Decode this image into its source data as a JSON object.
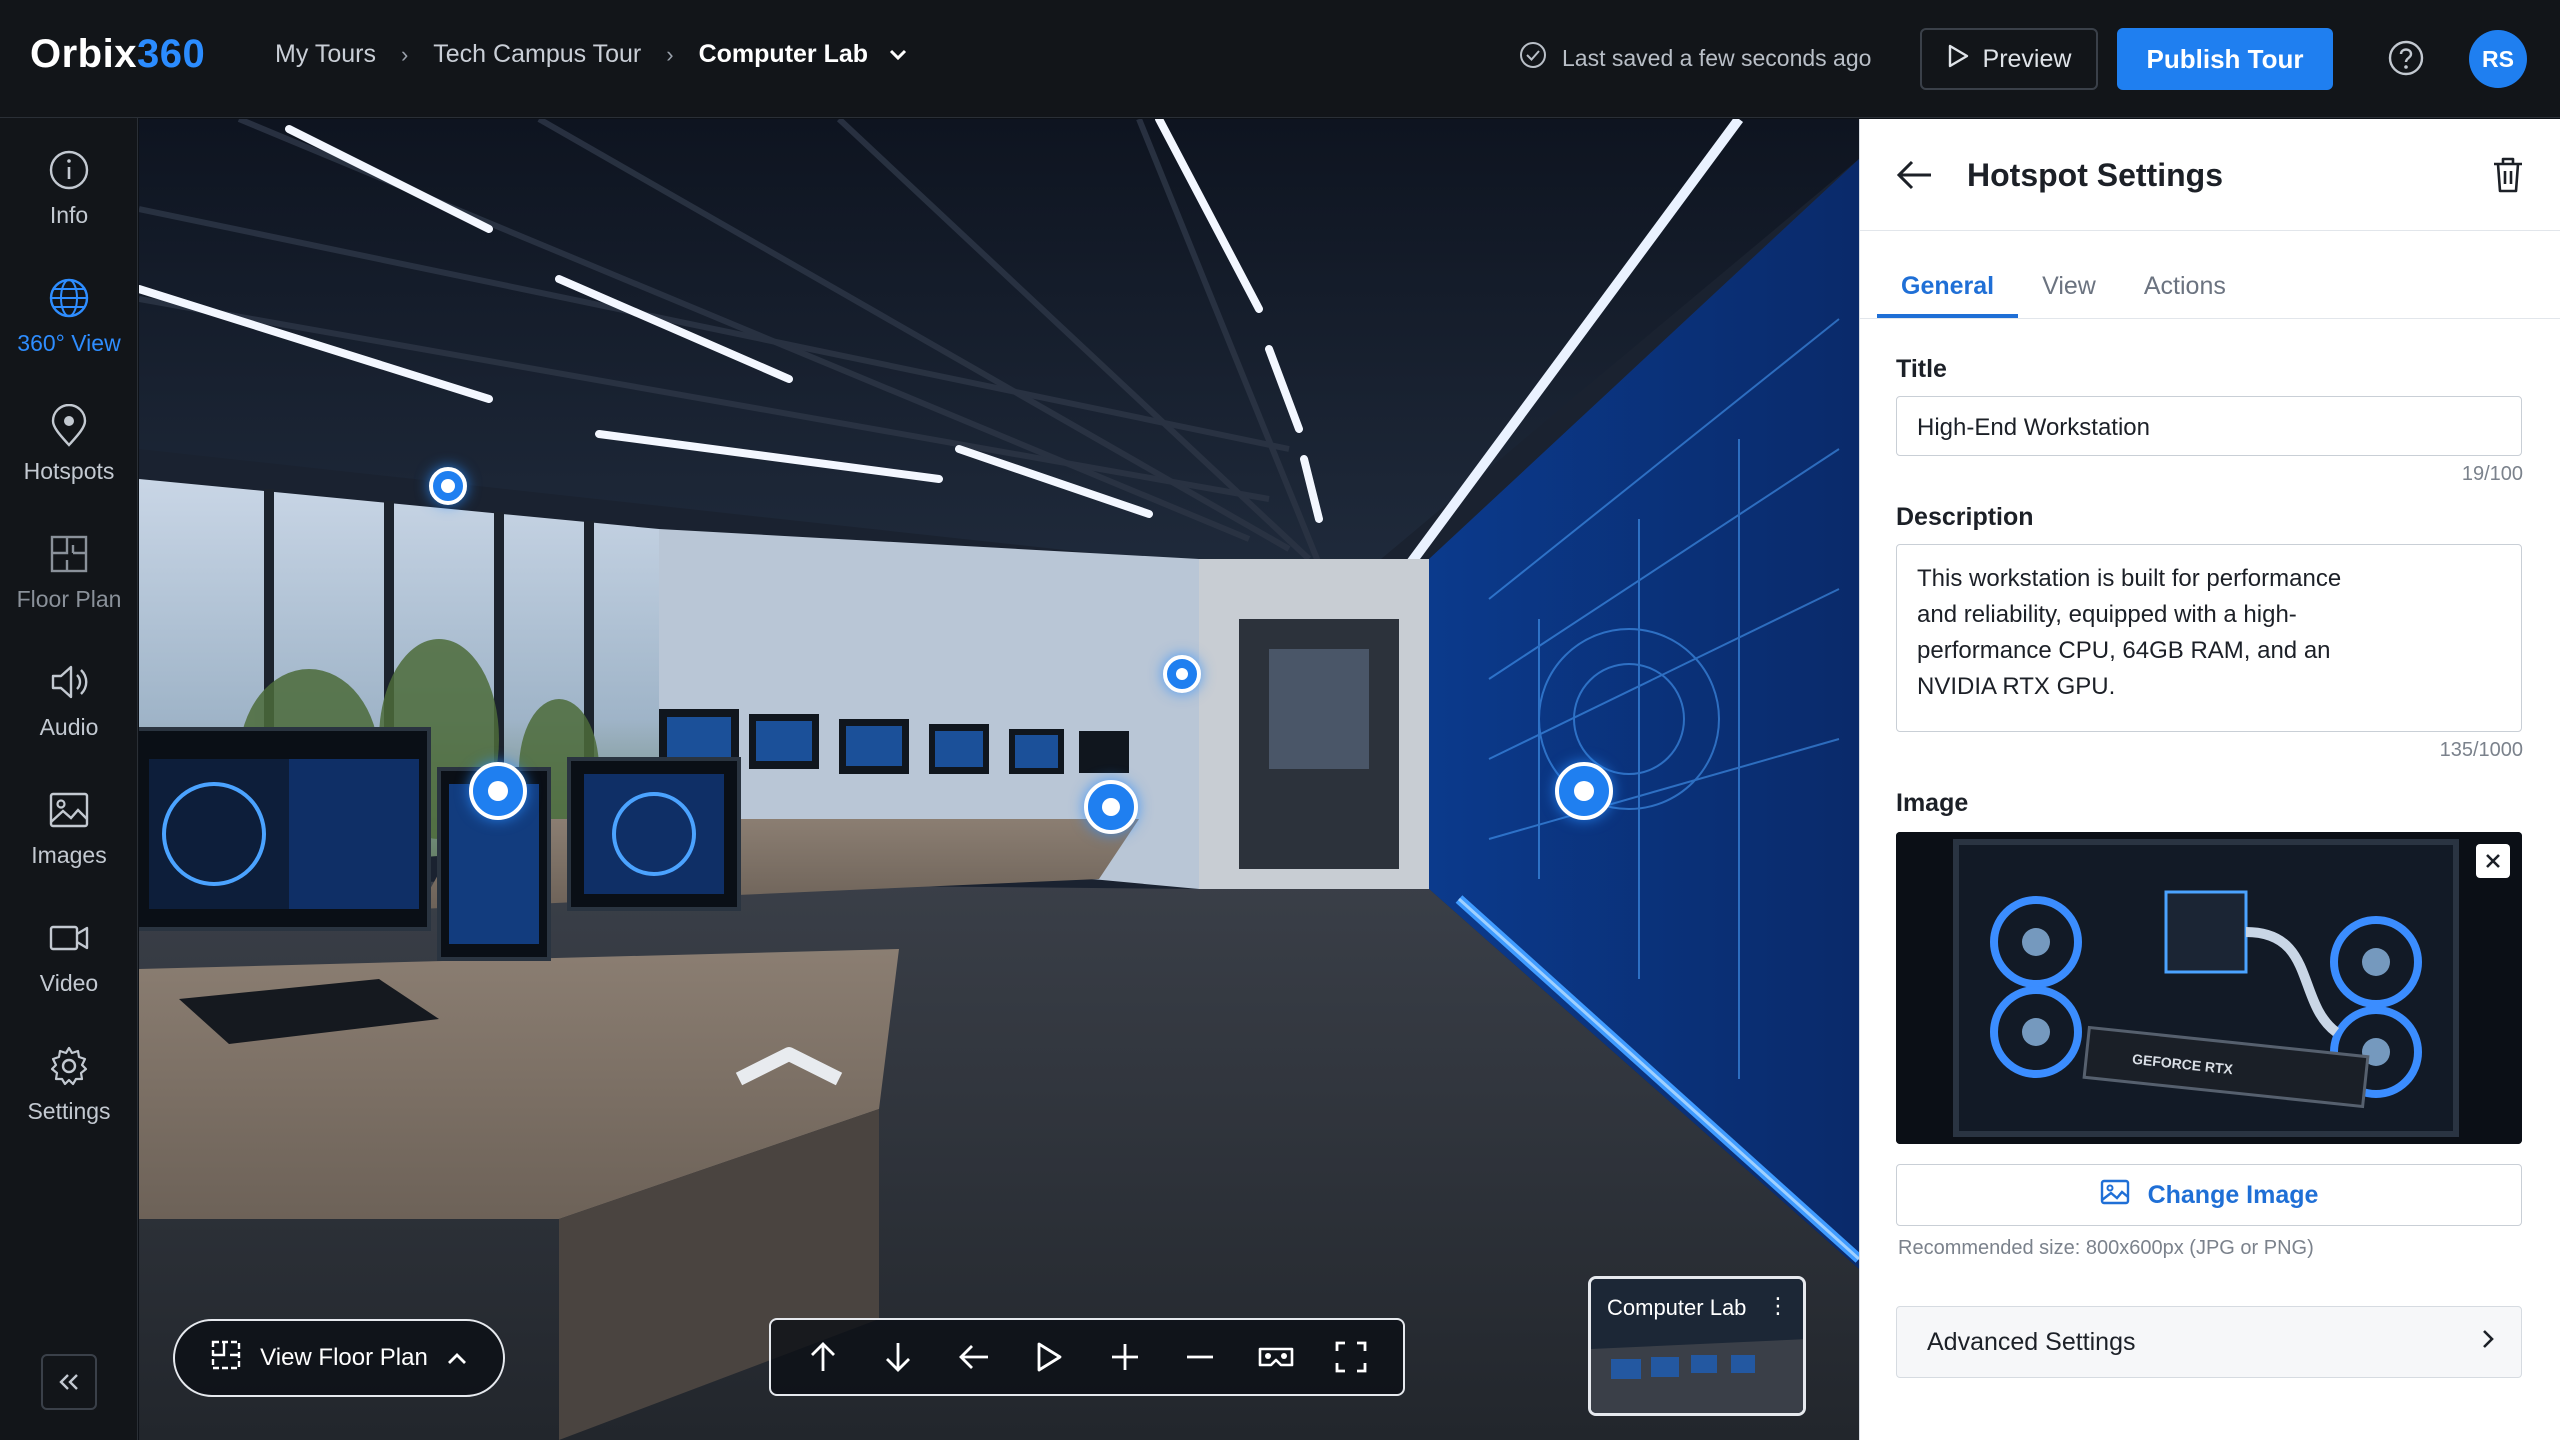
{
  "app": {
    "logo_part1": "Orbix",
    "logo_part2": "360",
    "brand_color": "#1f7ff0"
  },
  "breadcrumb": {
    "items": [
      "My Tours",
      "Tech Campus Tour",
      "Computer Lab"
    ]
  },
  "header": {
    "saved_status": "Last saved a few seconds ago",
    "preview_label": "Preview",
    "publish_label": "Publish Tour",
    "help_icon": "question-circle-icon",
    "avatar_initials": "RS"
  },
  "sidebar": {
    "items": [
      {
        "label": "Info",
        "icon": "info-icon"
      },
      {
        "label": "360° View",
        "icon": "globe-icon"
      },
      {
        "label": "Hotspots",
        "icon": "map-pin-icon"
      },
      {
        "label": "Floor Plan",
        "icon": "floor-plan-icon"
      },
      {
        "label": "Audio",
        "icon": "speaker-icon"
      },
      {
        "label": "Images",
        "icon": "image-icon"
      },
      {
        "label": "Video",
        "icon": "video-icon"
      },
      {
        "label": "Settings",
        "icon": "gear-icon"
      }
    ],
    "active_index": 1,
    "collapse_icon": "double-chevron-left-icon"
  },
  "viewer": {
    "floor_plan_label": "View Floor Plan",
    "thumbnail_label": "Computer Lab",
    "controls": [
      "arrow-up-icon",
      "arrow-down-icon",
      "arrow-left-icon",
      "play-icon",
      "zoom-in-icon",
      "zoom-out-icon",
      "vr-icon",
      "fullscreen-icon"
    ]
  },
  "panel": {
    "title": "Hotspot Settings",
    "tabs": [
      "General",
      "View",
      "Actions"
    ],
    "active_tab": "General",
    "title_label": "Title",
    "title_value": "High-End Workstation",
    "title_counter": "19/100",
    "description_label": "Description",
    "description_value": "This workstation is built for performance and reliability, equipped with a high-performance CPU, 64GB RAM, and an NVIDIA RTX GPU.",
    "description_counter": "135/1000",
    "image_label": "Image",
    "image_caption": "GEFORCE RTX",
    "change_image_label": "Change Image",
    "image_hint": "Recommended size: 800x600px (JPG or PNG)",
    "advanced_label": "Advanced Settings"
  }
}
